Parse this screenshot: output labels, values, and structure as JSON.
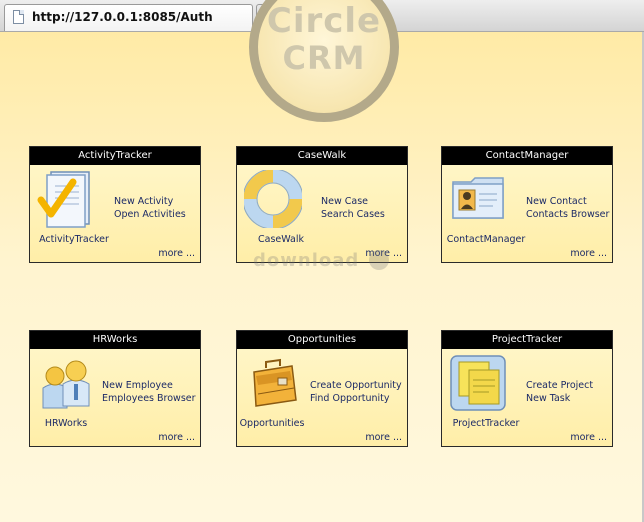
{
  "browser": {
    "tab_title": "http://127.0.0.1:8085/Auth",
    "new_tab_glyph": "⊹"
  },
  "logo": {
    "line1": "Circle",
    "line2": "CRM"
  },
  "watermark": "download",
  "modules": [
    {
      "title": "ActivityTracker",
      "name": "ActivityTracker",
      "links": [
        "New Activity",
        "Open Activities"
      ],
      "more": "more ...",
      "icon": "checklist-icon"
    },
    {
      "title": "CaseWalk",
      "name": "CaseWalk",
      "links": [
        "New Case",
        "Search Cases"
      ],
      "more": "more ...",
      "icon": "lifebuoy-icon"
    },
    {
      "title": "ContactManager",
      "name": "ContactManager",
      "links": [
        "New Contact",
        "Contacts Browser"
      ],
      "more": "more ...",
      "icon": "contact-card-icon"
    },
    {
      "title": "HRWorks",
      "name": "HRWorks",
      "links": [
        "New Employee",
        "Employees Browser"
      ],
      "more": "more ...",
      "icon": "people-icon"
    },
    {
      "title": "Opportunities",
      "name": "Opportunities",
      "links": [
        "Create Opportunity",
        "Find Opportunity"
      ],
      "more": "more ...",
      "icon": "briefcase-icon"
    },
    {
      "title": "ProjectTracker",
      "name": "ProjectTracker",
      "links": [
        "Create Project",
        "New Task"
      ],
      "more": "more ...",
      "icon": "sticky-notes-icon"
    }
  ]
}
